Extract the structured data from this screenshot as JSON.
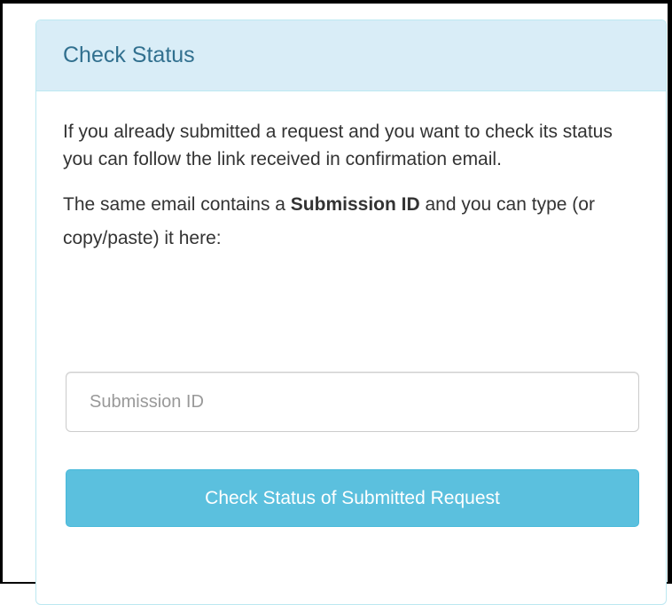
{
  "panel": {
    "title": "Check Status",
    "intro_text": "If you already submitted a request and you want to check its status you can follow the link received in confirmation email.",
    "instruction_prefix": "The same email contains a ",
    "instruction_bold": "Submission ID",
    "instruction_suffix": " and you can type (or copy/paste) it here:",
    "submission_input": {
      "value": "",
      "placeholder": "Submission ID"
    },
    "submit_button_label": "Check Status of Submitted Request"
  },
  "colors": {
    "heading_background": "#d9edf7",
    "heading_text": "#31708f",
    "panel_border": "#bce8f1",
    "button_background": "#5bc0de",
    "button_border": "#46b8da",
    "button_text": "#ffffff"
  }
}
